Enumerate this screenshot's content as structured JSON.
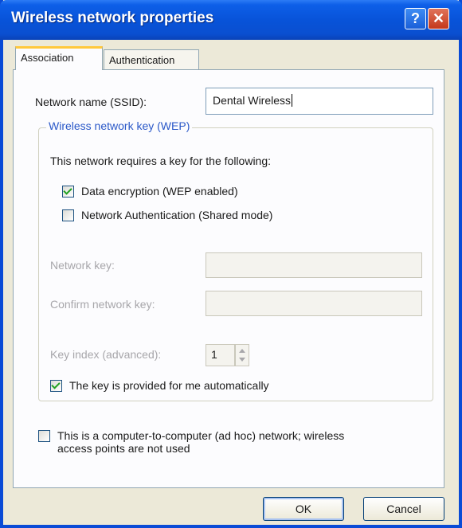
{
  "window": {
    "title": "Wireless network properties",
    "help_button": "?",
    "close_button": "✕"
  },
  "tabs": [
    {
      "label": "Association",
      "active": true
    },
    {
      "label": "Authentication",
      "active": false
    }
  ],
  "association": {
    "ssid_label": "Network name (SSID):",
    "ssid_value": "Dental Wireless",
    "wep_group": {
      "title": "Wireless network key (WEP)",
      "description": "This network requires a key for the following:",
      "data_encryption": {
        "label": "Data encryption (WEP enabled)",
        "checked": true
      },
      "network_authentication": {
        "label": "Network Authentication (Shared mode)",
        "checked": false
      },
      "network_key_label": "Network key:",
      "network_key_value": "",
      "confirm_key_label": "Confirm network key:",
      "confirm_key_value": "",
      "key_index_label": "Key index (advanced):",
      "key_index_value": "1",
      "key_auto": {
        "label": "The key is provided for me automatically",
        "checked": true
      }
    },
    "adhoc": {
      "label_line1": "This is a computer-to-computer (ad hoc) network; wireless",
      "label_line2": "access points are not used",
      "checked": false
    }
  },
  "buttons": {
    "ok": "OK",
    "cancel": "Cancel"
  },
  "colors": {
    "titlebar": "#0853d9",
    "frame": "#0a4bd6",
    "group_title": "#2a58c8",
    "check_mark": "#21a121"
  }
}
